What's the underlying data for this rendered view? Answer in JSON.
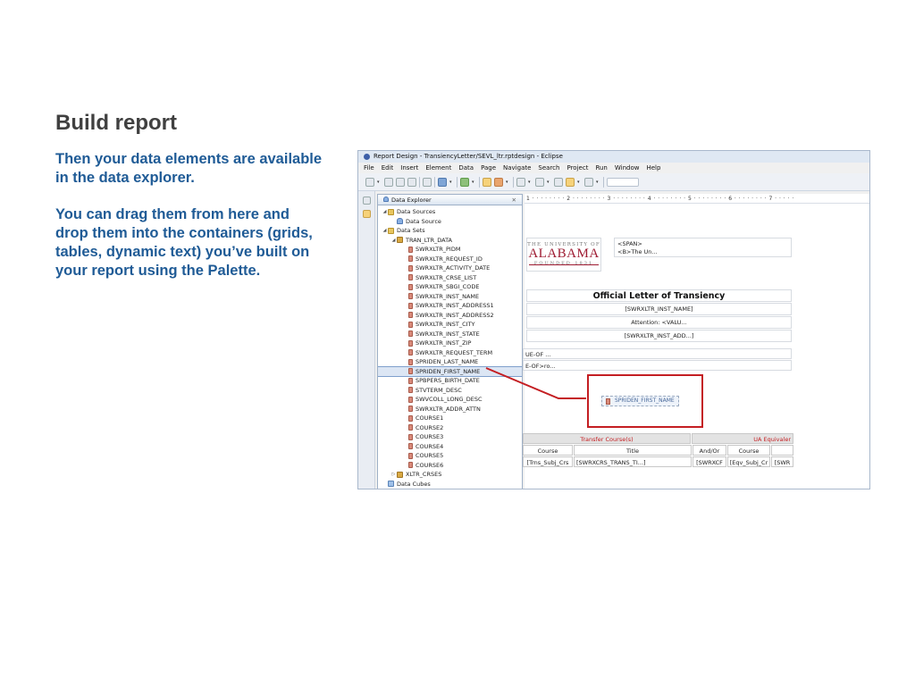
{
  "slide": {
    "title": "Build report",
    "para1": "Then your data elements are available in the data explorer.",
    "para2": "You can drag them from here and drop them into the containers (grids, tables, dynamic text) you’ve built on your report using the Palette."
  },
  "window": {
    "title": "Report Design - TransiencyLetter/SEVL_ltr.rptdesign - Eclipse",
    "menu": [
      "File",
      "Edit",
      "Insert",
      "Element",
      "Data",
      "Page",
      "Navigate",
      "Search",
      "Project",
      "Run",
      "Window",
      "Help"
    ]
  },
  "explorer": {
    "tab_label": "Data Explorer",
    "tab_close": "☒",
    "data_sources": "Data Sources",
    "data_source": "Data Source",
    "data_sets": "Data Sets",
    "dataset_name": "TRAN_LTR_DATA",
    "columns": [
      "SWRXLTR_PIDM",
      "SWRXLTR_REQUEST_ID",
      "SWRXLTR_ACTIVITY_DATE",
      "SWRXLTR_CRSE_LIST",
      "SWRXLTR_SBGI_CODE",
      "SWRXLTR_INST_NAME",
      "SWRXLTR_INST_ADDRESS1",
      "SWRXLTR_INST_ADDRESS2",
      "SWRXLTR_INST_CITY",
      "SWRXLTR_INST_STATE",
      "SWRXLTR_INST_ZIP",
      "SWRXLTR_REQUEST_TERM",
      "SPRIDEN_LAST_NAME",
      "SPRIDEN_FIRST_NAME",
      "SPBPERS_BIRTH_DATE",
      "STVTERM_DESC",
      "SWVCOLL_LONG_DESC",
      "SWRXLTR_ADDR_ATTN",
      "COURSE1",
      "COURSE2",
      "COURSE3",
      "COURSE4",
      "COURSE5",
      "COURSE6"
    ],
    "selected_column": "SPRIDEN_FIRST_NAME",
    "second_dataset": "XLTR_CRSES",
    "data_cubes": "Data Cubes"
  },
  "designer": {
    "ruler": "1 · · · · · · · · 2 · · · · · · · · 3 · · · · · · · · 4 · · · · · · · · 5 · · · · · · · · 6 · · · · · · · · 7 · · · · ·",
    "logo_top": "THE UNIVERSITY OF",
    "logo_main": "ALABAMA",
    "logo_bottom": "FOUNDED 1831",
    "span_line1": "<SPAN>",
    "span_line2": "<B>The Un...",
    "letter_title": "Official Letter of Transiency",
    "inst_name": "[SWRXLTR_INST_NAME]",
    "attention": "Attention: <VALU...",
    "inst_add": "[SWRXLTR_INST_ADD...]",
    "ue_of": "UE-OF ...",
    "e_of": "E-OF>ro...",
    "dropped_field": "SPRIDEN_FIRST_NAME",
    "transfer_header": "Transfer Course(s)",
    "ua_header": "UA Equivaler",
    "col_course": "Course",
    "col_title": "Title",
    "col_andor": "And/Or",
    "col_course2": "Course",
    "cell_trns": "[Trns_Subj_Crs",
    "cell_title": "[SWRXCRS_TRANS_TI...]",
    "cell_swrxcr": "[SWRXCF",
    "cell_eqv": "[Eqv_Subj_Cr",
    "cell_swr": "[SWR"
  }
}
